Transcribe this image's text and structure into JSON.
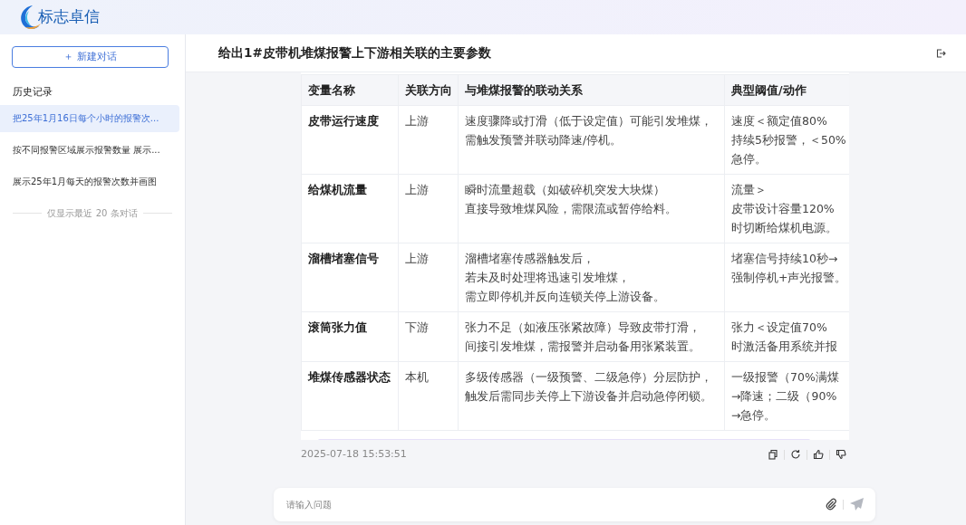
{
  "logo": {
    "text": "标志卓信"
  },
  "sidebar": {
    "new_chat": "＋ 新建对话",
    "history_label": "历史记录",
    "items": [
      {
        "label": "把25年1月16日每个小时的报警次...",
        "selected": true
      },
      {
        "label": "按不同报警区域展示报警数量 展示...",
        "selected": false
      },
      {
        "label": "展示25年1月每天的报警次数并画图",
        "selected": false
      }
    ],
    "footer_note": "仅显示最近 20 条对话"
  },
  "chat": {
    "title": "给出1#皮带机堆煤报警上下游相关联的主要参数",
    "table": {
      "columns": [
        "变量名称",
        "关联方向",
        "与堆煤报警的联动关系",
        "典型阈值/动作"
      ],
      "rows": [
        [
          [
            "皮带运行速度"
          ],
          [
            "上游"
          ],
          [
            "速度骤降或打滑（低于设定值）可能引发堆煤，",
            "需触发预警并联动降速/停机。"
          ],
          [
            "速度＜额定值80%",
            "持续5秒报警，＜50%",
            "急停。"
          ]
        ],
        [
          [
            "给煤机流量"
          ],
          [
            "上游"
          ],
          [
            "瞬时流量超载（如破碎机突发大块煤）",
            "直接导致堆煤风险，需限流或暂停给料。"
          ],
          [
            "流量＞",
            "皮带设计容量120%",
            "时切断给煤机电源。"
          ]
        ],
        [
          [
            "溜槽堵塞信号"
          ],
          [
            "上游"
          ],
          [
            "溜槽堵塞传感器触发后，",
            "若未及时处理将迅速引发堆煤，",
            "需立即停机并反向连锁关停上游设备。"
          ],
          [
            "堵塞信号持续10秒→",
            "强制停机+声光报警。"
          ]
        ],
        [
          [
            "滚筒张力值"
          ],
          [
            "下游"
          ],
          [
            "张力不足（如液压张紧故障）导致皮带打滑，",
            "间接引发堆煤，需报警并启动备用张紧装置。"
          ],
          [
            "张力＜设定值70%",
            "时激活备用系统并报"
          ]
        ],
        [
          [
            "堆煤传感器状态"
          ],
          [
            "本机"
          ],
          [
            "多级传感器（一级预警、二级急停）分层防护，",
            "触发后需同步关停上下游设备并启动急停闭锁。"
          ],
          [
            "一级报警（70%满煤",
            "→降速；二级（90%",
            "→急停。"
          ]
        ]
      ]
    },
    "timestamp": "2025-07-18 15:53:51",
    "input": {
      "placeholder": "请输入问题"
    }
  }
}
